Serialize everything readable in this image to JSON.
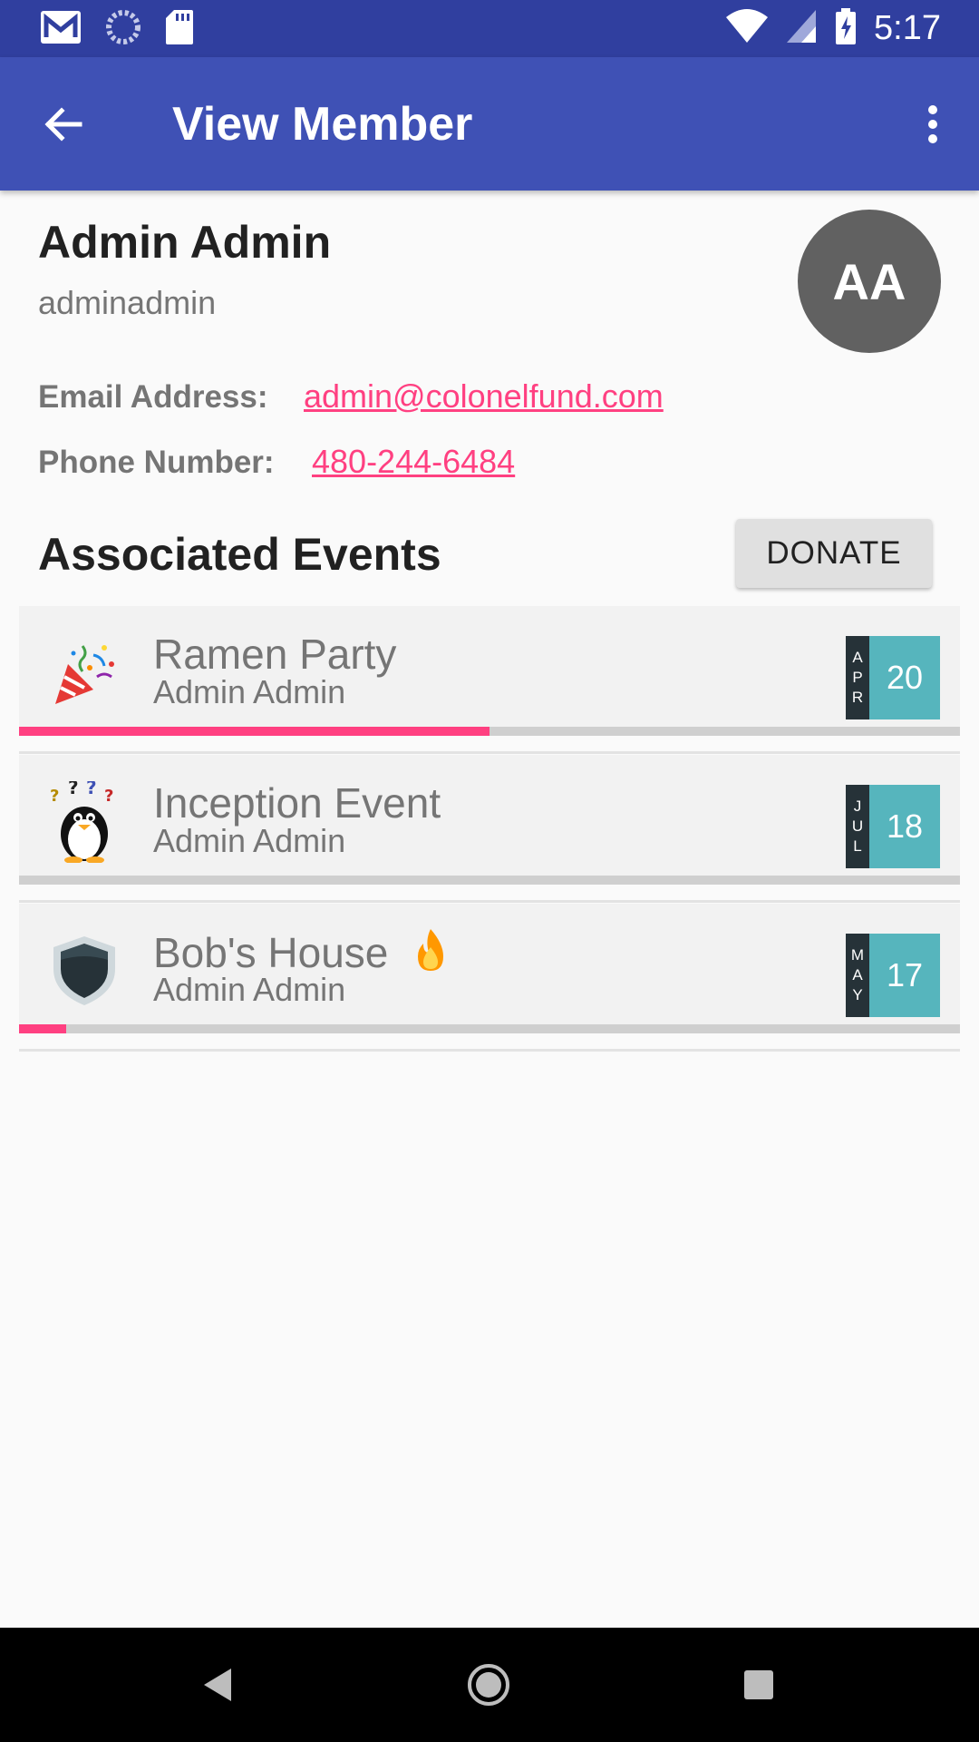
{
  "status_bar": {
    "time": "5:17",
    "left_icons": [
      "gmail-icon",
      "sync-icon",
      "sd-card-icon"
    ],
    "right_icons": [
      "wifi-icon",
      "signal-icon",
      "battery-charging-icon"
    ]
  },
  "app_bar": {
    "title": "View Member",
    "back_icon": "arrow-back-icon",
    "menu_icon": "more-vert-icon"
  },
  "member": {
    "name": "Admin Admin",
    "username": "adminadmin",
    "avatar_initials": "AA",
    "email_label": "Email Address:",
    "email": "admin@colonelfund.com",
    "phone_label": "Phone Number:",
    "phone": "480-244-6484"
  },
  "events_section": {
    "title": "Associated Events",
    "donate_label": "DONATE",
    "events": [
      {
        "name": "Ramen Party",
        "owner": "Admin Admin",
        "icon": "party-popper-icon",
        "month": [
          "A",
          "P",
          "R"
        ],
        "day": "20",
        "progress": 0.5,
        "emoji": ""
      },
      {
        "name": "Inception Event",
        "owner": "Admin Admin",
        "icon": "penguin-icon",
        "month": [
          "J",
          "U",
          "L"
        ],
        "day": "18",
        "progress": 0,
        "emoji": ""
      },
      {
        "name": "Bob's House",
        "owner": "Admin Admin",
        "icon": "shield-icon",
        "month": [
          "M",
          "A",
          "Y"
        ],
        "day": "17",
        "progress": 0.05,
        "emoji": "fire-icon"
      }
    ]
  },
  "colors": {
    "primary": "#3f51b5",
    "primary_dark": "#303f9f",
    "accent": "#ff4081",
    "date_day": "#56b5bd",
    "date_month": "#263238"
  },
  "nav_bar": {
    "back_icon": "nav-back-icon",
    "home_icon": "nav-home-icon",
    "recents_icon": "nav-recents-icon"
  }
}
